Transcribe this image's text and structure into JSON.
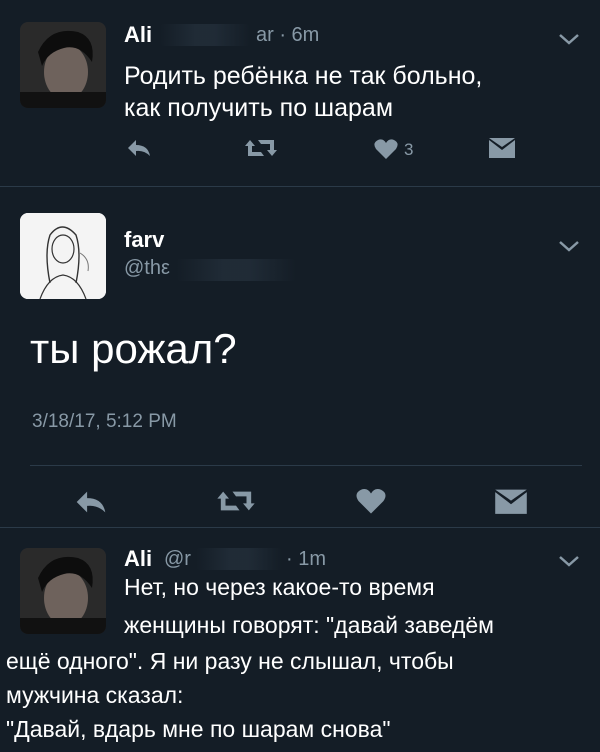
{
  "tweets": [
    {
      "name": "Ali",
      "handle": "ar · 6m",
      "text_lines": [
        "Родить ребёнка не так больно,",
        "как получить по шарам"
      ],
      "likes": "3"
    },
    {
      "name": "farv",
      "handle": "@thε",
      "text": "ты рожал?",
      "timestamp": "3/18/17, 5:12 PM"
    },
    {
      "name": "Ali",
      "handle": "@r",
      "time": "· 1m",
      "text_lines": [
        "Нет, но через какое-то время",
        "женщины говорят: \"давай заведём",
        "ещё одного\". Я ни разу не слышал, чтобы",
        "мужчина сказал:",
        "\"Давай, вдарь мне по шарам снова\""
      ]
    }
  ],
  "icons": {
    "reply": "reply-icon",
    "retweet": "retweet-icon",
    "like": "heart-icon",
    "dm": "envelope-icon",
    "menu": "chevron-down-icon"
  },
  "colors": {
    "background": "#141d26",
    "muted": "#8899a6",
    "divider": "#2b3a48",
    "text": "#ffffff"
  }
}
